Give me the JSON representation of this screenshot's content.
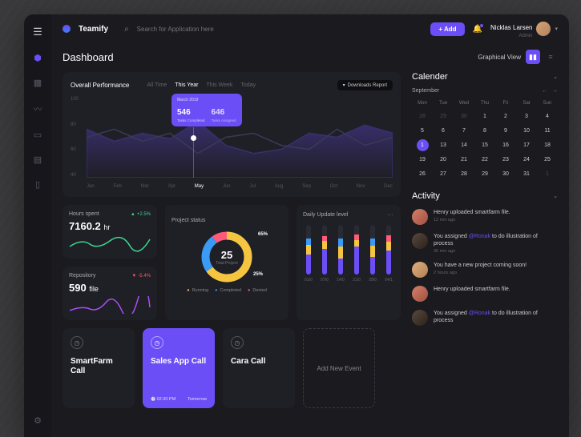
{
  "brand": "Teamify",
  "search": {
    "placeholder": "Search for Application here"
  },
  "add_btn": "+ Add",
  "user": {
    "name": "Nicklas Larsen",
    "role": "Admin"
  },
  "page_title": "Dashboard",
  "view_label": "Graphical View",
  "perf": {
    "title": "Overall Performance",
    "tabs": [
      "All Time",
      "This Year",
      "This Week",
      "Today"
    ],
    "active_tab": 1,
    "download": "Downloads Report",
    "tooltip": {
      "month": "March 2019",
      "v1": "546",
      "l1": "Tasks Completed",
      "v2": "646",
      "l2": "Tasks Assigned"
    }
  },
  "chart_data": {
    "type": "line",
    "x": [
      "Jan",
      "Feb",
      "Mar",
      "Apr",
      "May",
      "Jun",
      "Jul",
      "Aug",
      "Sep",
      "Oct",
      "Nov",
      "Dec"
    ],
    "ylim": [
      0,
      100
    ],
    "yticks": [
      100,
      80,
      60,
      40
    ],
    "series": [
      {
        "name": "Tasks Completed",
        "color": "#6b4ef5",
        "values": [
          60,
          45,
          55,
          48,
          70,
          40,
          30,
          35,
          55,
          50,
          65,
          55
        ]
      },
      {
        "name": "Tasks Assigned",
        "color": "#3a3a55",
        "values": [
          50,
          60,
          45,
          55,
          30,
          50,
          55,
          40,
          35,
          60,
          40,
          50
        ]
      }
    ],
    "highlight_index": 4
  },
  "hours": {
    "title": "Hours spent",
    "delta": "+2.5%",
    "dir": "up",
    "value": "7160.2",
    "unit": "hr"
  },
  "repo": {
    "title": "Repository",
    "delta": "-5.4%",
    "dir": "down",
    "value": "590",
    "unit": "file"
  },
  "project": {
    "title": "Project status",
    "total": "25",
    "total_label": "Total Project",
    "segments": [
      {
        "name": "Running",
        "pct": 65,
        "color": "#f5c542"
      },
      {
        "name": "Completed",
        "pct": 25,
        "color": "#3a9af5"
      },
      {
        "name": "Denied",
        "pct": 10,
        "color": "#ff5a7a"
      }
    ],
    "legend": [
      "Running",
      "Completed",
      "Denied"
    ]
  },
  "daily": {
    "title": "Daily Update level",
    "days": [
      "01/0",
      "07/0",
      "14/0",
      "21/0",
      "28/0",
      "04/1"
    ],
    "bars": [
      [
        {
          "c": "#6b4ef5",
          "h": 25
        },
        {
          "c": "#f5c542",
          "h": 12
        },
        {
          "c": "#3a9af5",
          "h": 8
        }
      ],
      [
        {
          "c": "#6b4ef5",
          "h": 32
        },
        {
          "c": "#f5c542",
          "h": 10
        },
        {
          "c": "#ff5a7a",
          "h": 6
        }
      ],
      [
        {
          "c": "#6b4ef5",
          "h": 20
        },
        {
          "c": "#f5c542",
          "h": 15
        },
        {
          "c": "#3a9af5",
          "h": 10
        }
      ],
      [
        {
          "c": "#6b4ef5",
          "h": 35
        },
        {
          "c": "#f5c542",
          "h": 8
        },
        {
          "c": "#ff5a7a",
          "h": 7
        }
      ],
      [
        {
          "c": "#6b4ef5",
          "h": 22
        },
        {
          "c": "#f5c542",
          "h": 14
        },
        {
          "c": "#3a9af5",
          "h": 9
        }
      ],
      [
        {
          "c": "#6b4ef5",
          "h": 30
        },
        {
          "c": "#f5c542",
          "h": 11
        },
        {
          "c": "#ff5a7a",
          "h": 8
        }
      ]
    ]
  },
  "events": [
    {
      "title": "SmartFarm Call",
      "time": "",
      "tag": "",
      "active": false
    },
    {
      "title": "Sales App Call",
      "time": "02:30 PM",
      "tag": "Tomorrow",
      "active": true
    },
    {
      "title": "Cara Call",
      "time": "",
      "tag": "",
      "active": false
    }
  ],
  "add_event": "Add New Event",
  "calendar": {
    "title": "Calender",
    "month": "September",
    "dow": [
      "Mon",
      "Tue",
      "Wed",
      "Thu",
      "Fri",
      "Sat",
      "Sun"
    ],
    "cells": [
      {
        "n": 28,
        "dim": true
      },
      {
        "n": 29,
        "dim": true
      },
      {
        "n": 30,
        "dim": true
      },
      {
        "n": 1
      },
      {
        "n": 2
      },
      {
        "n": 3
      },
      {
        "n": 4
      },
      {
        "n": 5
      },
      {
        "n": 6
      },
      {
        "n": 7
      },
      {
        "n": 8
      },
      {
        "n": 9
      },
      {
        "n": 10
      },
      {
        "n": 11
      },
      {
        "n": 1,
        "sel": true
      },
      {
        "n": 13
      },
      {
        "n": 14
      },
      {
        "n": 15
      },
      {
        "n": 16
      },
      {
        "n": 17
      },
      {
        "n": 18
      },
      {
        "n": 19
      },
      {
        "n": 20
      },
      {
        "n": 21
      },
      {
        "n": 22
      },
      {
        "n": 23
      },
      {
        "n": 24
      },
      {
        "n": 25
      },
      {
        "n": 26
      },
      {
        "n": 27
      },
      {
        "n": 28
      },
      {
        "n": 29
      },
      {
        "n": 30
      },
      {
        "n": 31
      },
      {
        "n": 1,
        "dim": true
      }
    ]
  },
  "activity": {
    "title": "Activity",
    "items": [
      {
        "av": "av1",
        "text": "Henry uploaded smartfarm file.",
        "time": "12 min ago"
      },
      {
        "av": "av2",
        "text": "You assigned <span class='mention'>@Ronak</span> to do illustration of process",
        "time": "36 min ago"
      },
      {
        "av": "av3",
        "text": "You have a new project coming soon!",
        "time": "2 hours ago"
      },
      {
        "av": "av1",
        "text": "Henry uploaded smartfarm file.",
        "time": ""
      },
      {
        "av": "av2",
        "text": "You assigned <span class='mention'>@Ronak</span> to do illustration of process",
        "time": ""
      }
    ]
  }
}
